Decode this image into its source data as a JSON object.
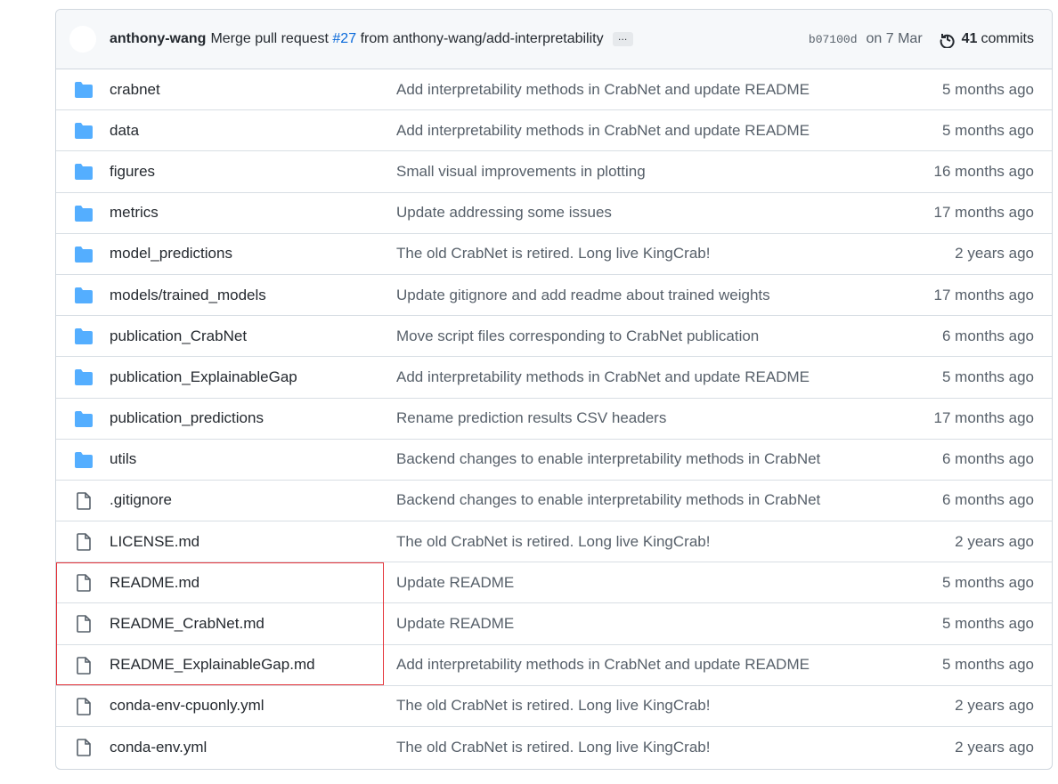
{
  "commit": {
    "author": "anthony-wang",
    "message_prefix": "Merge pull request",
    "pr": "#27",
    "message_suffix": "from anthony-wang/add-interpretability",
    "more": "…",
    "sha": "b07100d",
    "date": "on 7 Mar",
    "commits_count": "41",
    "commits_label": "commits"
  },
  "colors": {
    "folder": "#54aeff",
    "link": "#0969da",
    "highlight": "#e5343a"
  },
  "files": [
    {
      "type": "folder",
      "name": "crabnet",
      "message": "Add interpretability methods in CrabNet and update README",
      "time": "5 months ago"
    },
    {
      "type": "folder",
      "name": "data",
      "message": "Add interpretability methods in CrabNet and update README",
      "time": "5 months ago"
    },
    {
      "type": "folder",
      "name": "figures",
      "message": "Small visual improvements in plotting",
      "time": "16 months ago"
    },
    {
      "type": "folder",
      "name": "metrics",
      "message": "Update addressing some issues",
      "time": "17 months ago"
    },
    {
      "type": "folder",
      "name": "model_predictions",
      "message": "The old CrabNet is retired. Long live KingCrab!",
      "time": "2 years ago"
    },
    {
      "type": "folder",
      "name": "models/trained_models",
      "message": "Update gitignore and add readme about trained weights",
      "time": "17 months ago"
    },
    {
      "type": "folder",
      "name": "publication_CrabNet",
      "message": "Move script files corresponding to CrabNet publication",
      "time": "6 months ago"
    },
    {
      "type": "folder",
      "name": "publication_ExplainableGap",
      "message": "Add interpretability methods in CrabNet and update README",
      "time": "5 months ago"
    },
    {
      "type": "folder",
      "name": "publication_predictions",
      "message": "Rename prediction results CSV headers",
      "time": "17 months ago"
    },
    {
      "type": "folder",
      "name": "utils",
      "message": "Backend changes to enable interpretability methods in CrabNet",
      "time": "6 months ago"
    },
    {
      "type": "file",
      "name": ".gitignore",
      "message": "Backend changes to enable interpretability methods in CrabNet",
      "time": "6 months ago"
    },
    {
      "type": "file",
      "name": "LICENSE.md",
      "message": "The old CrabNet is retired. Long live KingCrab!",
      "time": "2 years ago"
    },
    {
      "type": "file",
      "name": "README.md",
      "message": "Update README",
      "time": "5 months ago"
    },
    {
      "type": "file",
      "name": "README_CrabNet.md",
      "message": "Update README",
      "time": "5 months ago"
    },
    {
      "type": "file",
      "name": "README_ExplainableGap.md",
      "message": "Add interpretability methods in CrabNet and update README",
      "time": "5 months ago"
    },
    {
      "type": "file",
      "name": "conda-env-cpuonly.yml",
      "message": "The old CrabNet is retired. Long live KingCrab!",
      "time": "2 years ago"
    },
    {
      "type": "file",
      "name": "conda-env.yml",
      "message": "The old CrabNet is retired. Long live KingCrab!",
      "time": "2 years ago"
    }
  ]
}
